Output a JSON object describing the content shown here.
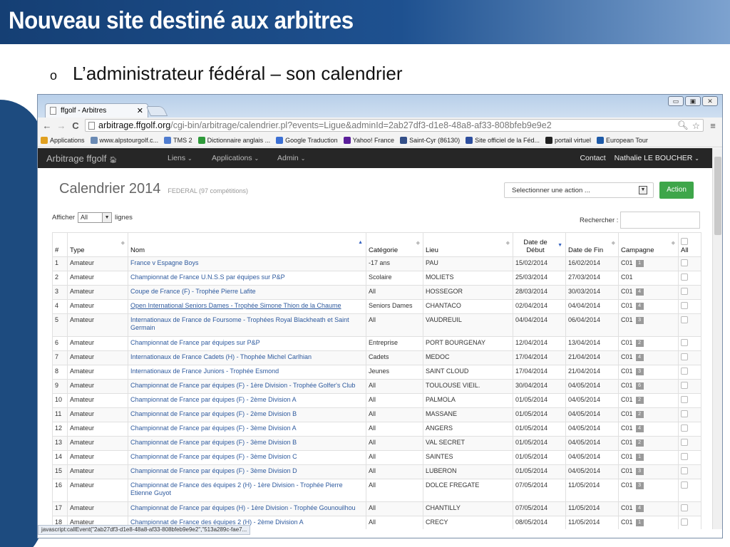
{
  "slide": {
    "title": "Nouveau site destiné aux arbitres",
    "bullet_marker": "o",
    "bullet": "L’administrateur  fédéral – son calendrier"
  },
  "browser": {
    "tab_title": "ffgolf - Arbitres",
    "url_host": "arbitrage.ffgolf.org",
    "url_path": "/cgi-bin/arbitrage/calendrier.pl?events=Ligue&adminId=2ab27df3-d1e8-48a8-af33-808bfeb9e9e2",
    "bookmarks": [
      {
        "label": "Applications",
        "icon": "apps-grid-icon",
        "color": "#e0a020"
      },
      {
        "label": "www.alpstourgolf.c...",
        "icon": "page-icon",
        "color": "#6a8ab4"
      },
      {
        "label": "TMS 2",
        "icon": "page-icon",
        "color": "#4f7ccf"
      },
      {
        "label": "Dictionnaire anglais ...",
        "icon": "l-icon",
        "color": "#2e9a3a"
      },
      {
        "label": "Google Traduction",
        "icon": "translate-icon",
        "color": "#3b6fd4"
      },
      {
        "label": "Yahoo! France",
        "icon": "y-icon",
        "color": "#5a1e9a"
      },
      {
        "label": "Saint-Cyr (86130)",
        "icon": "building-icon",
        "color": "#334f88"
      },
      {
        "label": "Site officiel de la Féd...",
        "icon": "flag-icon",
        "color": "#2d4e9e"
      },
      {
        "label": "portail virtuel",
        "icon": "s-icon",
        "color": "#222222"
      },
      {
        "label": "European Tour",
        "icon": "tour-icon",
        "color": "#1d5aa8"
      }
    ],
    "status_text": "javascript:callEvent(\"2ab27df3-d1e8-48a8-af33-808bfeb9e9e2\",\"513a289c-fae7..."
  },
  "navbar": {
    "brand": "Arbitrage ffgolf",
    "menus": [
      "Liens",
      "Applications",
      "Admin"
    ],
    "contact": "Contact",
    "user": "Nathalie LE BOUCHER"
  },
  "page": {
    "title": "Calendrier 2014",
    "subtitle": "FEDERAL  (97 compétitions)",
    "action_select": "Selectionner une action ...",
    "action_button": "Action",
    "show_prefix": "Afficher",
    "show_value": "All",
    "show_suffix": "lignes",
    "search_label": "Rechercher :"
  },
  "table": {
    "headers": [
      "#",
      "Type",
      "Nom",
      "Catégorie",
      "Lieu",
      "Date de Début",
      "Date de Fin",
      "Campagne",
      "All"
    ],
    "rows": [
      {
        "n": "1",
        "type": "Amateur",
        "nom": "France v Espagne Boys",
        "cat": "-17 ans",
        "lieu": "PAU",
        "debut": "15/02/2014",
        "fin": "16/02/2014",
        "camp": "C01",
        "badge": "1"
      },
      {
        "n": "2",
        "type": "Amateur",
        "nom": "Championnat de France U.N.S.S par équipes sur P&P",
        "cat": "Scolaire",
        "lieu": "MOLIETS",
        "debut": "25/03/2014",
        "fin": "27/03/2014",
        "camp": "C01",
        "badge": ""
      },
      {
        "n": "3",
        "type": "Amateur",
        "nom": "Coupe de France (F) - Trophée Pierre Lafite",
        "cat": "All",
        "lieu": "HOSSEGOR",
        "debut": "28/03/2014",
        "fin": "30/03/2014",
        "camp": "C01",
        "badge": "4"
      },
      {
        "n": "4",
        "type": "Amateur",
        "nom": "Open International Seniors Dames - Trophée Simone Thion de la Chaume",
        "cat": "Seniors Dames",
        "lieu": "CHANTACO",
        "debut": "02/04/2014",
        "fin": "04/04/2014",
        "camp": "C01",
        "badge": "4",
        "underline": true
      },
      {
        "n": "5",
        "type": "Amateur",
        "nom": "Internationaux de France de Foursome - Trophées Royal Blackheath et Saint Germain",
        "cat": "All",
        "lieu": "VAUDREUIL",
        "debut": "04/04/2014",
        "fin": "06/04/2014",
        "camp": "C01",
        "badge": "3",
        "tall": true
      },
      {
        "n": "6",
        "type": "Amateur",
        "nom": "Championnat de France par équipes sur P&P",
        "cat": "Entreprise",
        "lieu": "PORT BOURGENAY",
        "debut": "12/04/2014",
        "fin": "13/04/2014",
        "camp": "C01",
        "badge": "2"
      },
      {
        "n": "7",
        "type": "Amateur",
        "nom": "Internationaux de France Cadets (H) - Thophée Michel Carlhian",
        "cat": "Cadets",
        "lieu": "MEDOC",
        "debut": "17/04/2014",
        "fin": "21/04/2014",
        "camp": "C01",
        "badge": "4"
      },
      {
        "n": "8",
        "type": "Amateur",
        "nom": "Internationaux de France Juniors - Trophée Esmond",
        "cat": "Jeunes",
        "lieu": "SAINT CLOUD",
        "debut": "17/04/2014",
        "fin": "21/04/2014",
        "camp": "C01",
        "badge": "3"
      },
      {
        "n": "9",
        "type": "Amateur",
        "nom": "Championnat de France par équipes (F) - 1ère Division - Trophée Golfer's Club",
        "cat": "All",
        "lieu": "TOULOUSE VIEIL.",
        "debut": "30/04/2014",
        "fin": "04/05/2014",
        "camp": "C01",
        "badge": "6"
      },
      {
        "n": "10",
        "type": "Amateur",
        "nom": "Championnat de France par équipes (F) - 2ème Division A",
        "cat": "All",
        "lieu": "PALMOLA",
        "debut": "01/05/2014",
        "fin": "04/05/2014",
        "camp": "C01",
        "badge": "2"
      },
      {
        "n": "11",
        "type": "Amateur",
        "nom": "Championnat de France par équipes (F) - 2ème Division B",
        "cat": "All",
        "lieu": "MASSANE",
        "debut": "01/05/2014",
        "fin": "04/05/2014",
        "camp": "C01",
        "badge": "2"
      },
      {
        "n": "12",
        "type": "Amateur",
        "nom": "Championnat de France par équipes (F) - 3ème Division A",
        "cat": "All",
        "lieu": "ANGERS",
        "debut": "01/05/2014",
        "fin": "04/05/2014",
        "camp": "C01",
        "badge": "4"
      },
      {
        "n": "13",
        "type": "Amateur",
        "nom": "Championnat de France par équipes (F) - 3ème Division B",
        "cat": "All",
        "lieu": "VAL SECRET",
        "debut": "01/05/2014",
        "fin": "04/05/2014",
        "camp": "C01",
        "badge": "2"
      },
      {
        "n": "14",
        "type": "Amateur",
        "nom": "Championnat de France par équipes (F) - 3ème Division C",
        "cat": "All",
        "lieu": "SAINTES",
        "debut": "01/05/2014",
        "fin": "04/05/2014",
        "camp": "C01",
        "badge": "1"
      },
      {
        "n": "15",
        "type": "Amateur",
        "nom": "Championnat de France par équipes (F) - 3ème Division D",
        "cat": "All",
        "lieu": "LUBERON",
        "debut": "01/05/2014",
        "fin": "04/05/2014",
        "camp": "C01",
        "badge": "3"
      },
      {
        "n": "16",
        "type": "Amateur",
        "nom": "Championnat de France des équipes 2 (H) - 1ère Division - Trophée Pierre Etienne Guyot",
        "cat": "All",
        "lieu": "DOLCE FREGATE",
        "debut": "07/05/2014",
        "fin": "11/05/2014",
        "camp": "C01",
        "badge": "3",
        "tall": true
      },
      {
        "n": "17",
        "type": "Amateur",
        "nom": "Championnat de France par équipes (H) - 1ère Division - Trophée Gounouilhou",
        "cat": "All",
        "lieu": "CHANTILLY",
        "debut": "07/05/2014",
        "fin": "11/05/2014",
        "camp": "C01",
        "badge": "4"
      },
      {
        "n": "18",
        "type": "Amateur",
        "nom": "Championnat de France des équipes 2 (H) - 2ème Division A",
        "cat": "All",
        "lieu": "CRECY",
        "debut": "08/05/2014",
        "fin": "11/05/2014",
        "camp": "C01",
        "badge": "1"
      }
    ]
  }
}
